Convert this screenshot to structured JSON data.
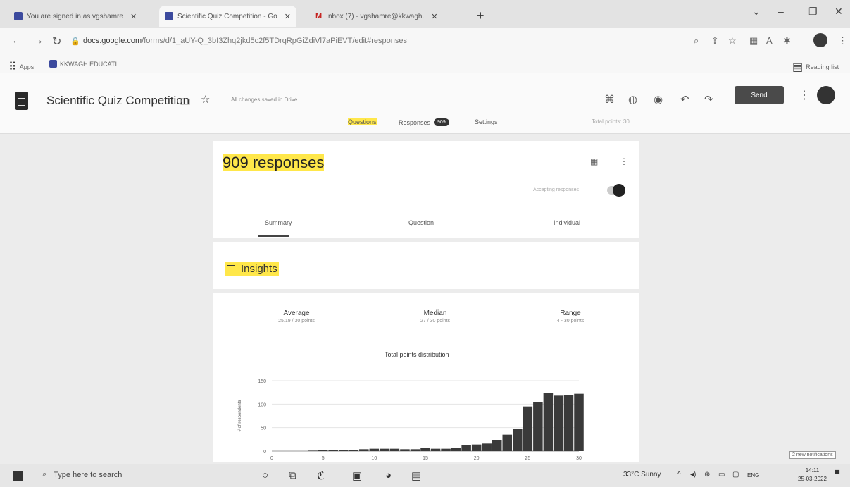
{
  "browser": {
    "tabs": [
      {
        "title": "You are signed in as vgshamre",
        "active": false
      },
      {
        "title": "Scientific Quiz Competition - Go",
        "active": true
      },
      {
        "title": "Inbox (7) - vgshamre@kkwagh.",
        "active": false
      }
    ],
    "url_host": "docs.google.com",
    "url_path": "/forms/d/1_aUY-Q_3bI3Zhq2jkd5c2f5TDrqRpGiZdiVl7aPiEVT/edit#responses",
    "bookmarks": [
      "Apps",
      "KKWAGH EDUCATI..."
    ],
    "reading_list": "Reading list"
  },
  "form": {
    "title": "Scientific Quiz Competition",
    "saved_status": "All changes saved in Drive",
    "send_label": "Send",
    "tabs": {
      "questions": "Questions",
      "responses": "Responses",
      "responses_count": "909",
      "settings": "Settings"
    },
    "total_points": "Total points: 30"
  },
  "responses": {
    "heading": "909 responses",
    "accepting_label": "Accepting responses",
    "subtabs": [
      "Summary",
      "Question",
      "Individual"
    ],
    "insights_label": "Insights",
    "stats": [
      {
        "label": "Average",
        "value": "25.19 / 30 points"
      },
      {
        "label": "Median",
        "value": "27 / 30 points"
      },
      {
        "label": "Range",
        "value": "4 - 30 points"
      }
    ]
  },
  "chart_data": {
    "type": "bar",
    "title": "Total points distribution",
    "xlabel": "",
    "ylabel": "# of respondents",
    "xlim": [
      0,
      30
    ],
    "ylim": [
      0,
      150
    ],
    "yticks": [
      0,
      50,
      100,
      150
    ],
    "xticks": [
      0,
      5,
      10,
      15,
      20,
      25,
      30
    ],
    "categories": [
      4,
      5,
      6,
      7,
      8,
      9,
      10,
      11,
      12,
      13,
      14,
      15,
      16,
      17,
      18,
      19,
      20,
      21,
      22,
      23,
      24,
      25,
      26,
      27,
      28,
      29,
      30
    ],
    "values": [
      1,
      2,
      2,
      3,
      3,
      4,
      5,
      5,
      5,
      4,
      4,
      6,
      5,
      5,
      6,
      12,
      14,
      16,
      24,
      35,
      47,
      95,
      105,
      123,
      118,
      120,
      122
    ]
  },
  "taskbar": {
    "search_placeholder": "Type here to search",
    "weather": "33°C  Sunny",
    "language": "ENG",
    "time": "14:11",
    "date": "25-03-2022",
    "notification": "2 new notifications"
  }
}
